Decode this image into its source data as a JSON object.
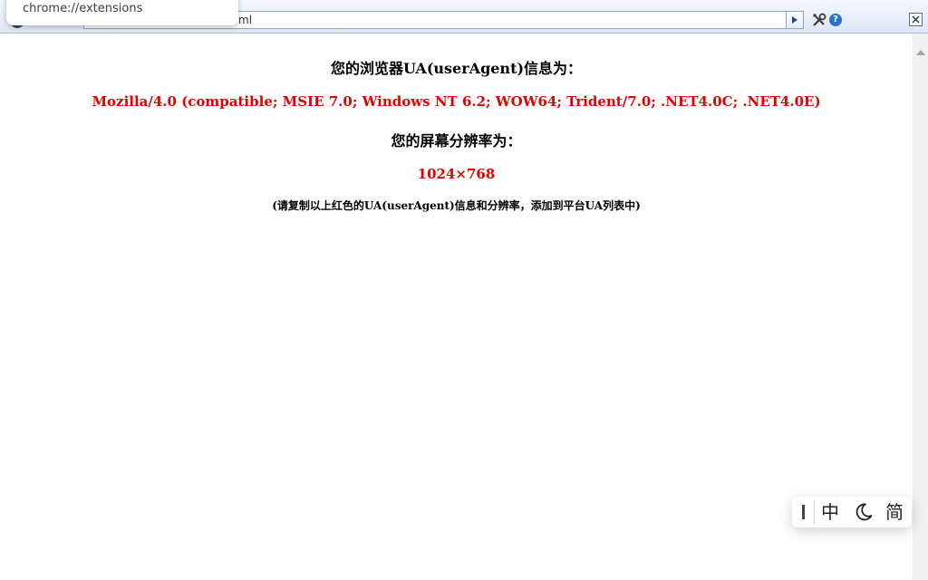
{
  "browser": {
    "address_text": "ml",
    "suggestion": "chrome://extensions",
    "help_glyph": "?"
  },
  "page": {
    "ua_heading": "您的浏览器UA(userAgent)信息为：",
    "ua_value": "Mozilla/4.0 (compatible; MSIE 7.0; Windows NT 6.2; WOW64; Trident/7.0; .NET4.0C; .NET4.0E)",
    "resolution_heading": "您的屏幕分辨率为：",
    "resolution_value": "1024×768",
    "note": "(请复制以上红色的UA(userAgent)信息和分辨率，添加到平台UA列表中)"
  },
  "ime": {
    "language_label": "中",
    "script_label": "简"
  },
  "colors": {
    "accent_red": "#e60000",
    "toolbar_top": "#f4f8fd",
    "toolbar_bottom": "#dde8f6"
  },
  "icons": [
    "info-icon",
    "go-arrow-icon",
    "tools-icon",
    "help-icon",
    "close-icon",
    "moon-icon"
  ]
}
